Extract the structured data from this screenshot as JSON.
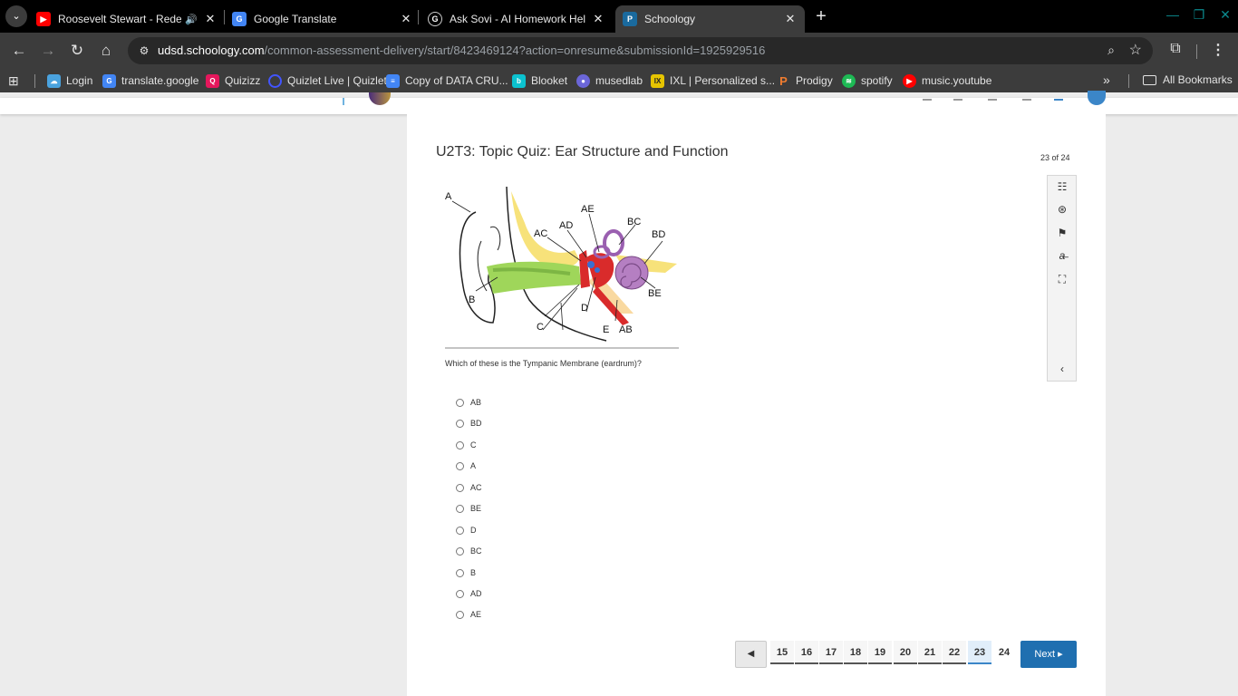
{
  "browser": {
    "tabs": [
      {
        "title": "Roosevelt Stewart - Redeem",
        "favicon": "youtube-icon",
        "close": "✕"
      },
      {
        "title": "Google Translate",
        "favicon": "google-translate-icon",
        "close": "✕"
      },
      {
        "title": "Ask Sovi - AI Homework Helper",
        "favicon": "sovi-icon",
        "close": "✕"
      },
      {
        "title": "Schoology",
        "favicon": "schoology-icon",
        "close": "✕"
      }
    ],
    "url_host": "udsd.schoology.com",
    "url_path": "/common-assessment-delivery/start/8423469124?action=onresume&submissionId=1925929516",
    "bookmarks": [
      {
        "label": "Login"
      },
      {
        "label": "translate.google"
      },
      {
        "label": "Quizizz"
      },
      {
        "label": "Quizlet Live | Quizlet"
      },
      {
        "label": "Copy of DATA CRU..."
      },
      {
        "label": "Blooket"
      },
      {
        "label": "musedlab"
      },
      {
        "label": "IXL | Personalized s..."
      },
      {
        "label": "Prodigy"
      },
      {
        "label": "spotify"
      },
      {
        "label": "music.youtube"
      }
    ],
    "all_bookmarks": "All Bookmarks",
    "accent": "#0b8a8e"
  },
  "quiz": {
    "title": "U2T3: Topic Quiz: Ear Structure and Function",
    "counter": "23 of 24",
    "question": "Which of these is the Tympanic Membrane (eardrum)?",
    "diagram_labels": {
      "A": "A",
      "AE": "AE",
      "AD": "AD",
      "AC": "AC",
      "BC": "BC",
      "BD": "BD",
      "BE": "BE",
      "B": "B",
      "D": "D",
      "C": "C",
      "E": "E",
      "AB": "AB"
    },
    "choices": [
      "AB",
      "BD",
      "C",
      "A",
      "AC",
      "BE",
      "D",
      "BC",
      "B",
      "AD",
      "AE"
    ],
    "tools": [
      "list-icon",
      "accessibility-icon",
      "flag-icon",
      "strikethrough-icon",
      "fullscreen-icon",
      "collapse-icon"
    ]
  },
  "pager": {
    "pages": [
      "15",
      "16",
      "17",
      "18",
      "19",
      "20",
      "21",
      "22",
      "23",
      "24"
    ],
    "current": "23",
    "next_label": "Next ▸",
    "prev_label": "◀"
  }
}
